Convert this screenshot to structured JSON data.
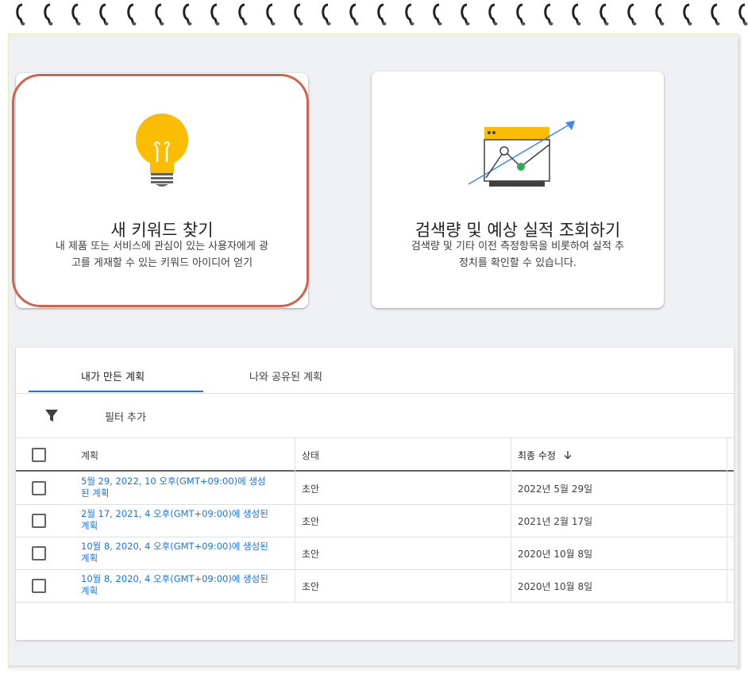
{
  "cards": [
    {
      "title": "새 키워드 찾기",
      "desc_line1": "내 제품 또는 서비스에 관심이 있는 사용자에게 광",
      "desc_line2": "고를 게재할 수 있는 키워드 아이디어 얻기",
      "icon": "lightbulb-icon"
    },
    {
      "title": "검색량 및 예상 실적 조회하기",
      "desc_line1": "검색량 및 기타 이전 측정항목을 비롯하여 실적 추",
      "desc_line2": "정치를 확인할 수 있습니다.",
      "icon": "forecast-chart-icon"
    }
  ],
  "tabs": {
    "my_plans": "내가 만든 계획",
    "shared_plans": "나와 공유된 계획"
  },
  "filter": {
    "label": "필터 추가",
    "icon": "filter-icon"
  },
  "table": {
    "headers": {
      "plan": "계획",
      "status": "상태",
      "last_modified": "최종 수정",
      "sort_icon": "arrow-down-icon"
    },
    "rows": [
      {
        "plan_line1": "5월 29, 2022, 10 오후(GMT+09:00)에 생성",
        "plan_line2": "된 계획",
        "status": "초안",
        "date": "2022년 5월 29일"
      },
      {
        "plan_line1": "2월 17, 2021, 4 오후(GMT+09:00)에 생성된",
        "plan_line2": "계획",
        "status": "초안",
        "date": "2021년 2월 17일"
      },
      {
        "plan_line1": "10월 8, 2020, 4 오후(GMT+09:00)에 생성된",
        "plan_line2": "계획",
        "status": "초안",
        "date": "2020년 10월 8일"
      },
      {
        "plan_line1": "10월 8, 2020, 4 오후(GMT+09:00)에 생성된",
        "plan_line2": "계획",
        "status": "초안",
        "date": "2020년 10월 8일"
      }
    ]
  },
  "colors": {
    "accent": "#1a73e8",
    "highlight": "#d0644a",
    "bulb": "#fbbc04",
    "green": "#34a853"
  }
}
